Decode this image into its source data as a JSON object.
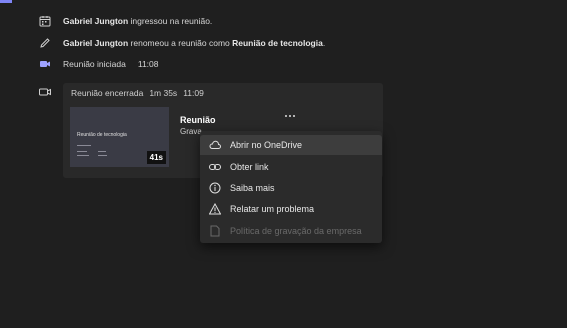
{
  "events": {
    "joined": {
      "name": "Gabriel Jungton",
      "text": " ingressou na reunião."
    },
    "renamed": {
      "name": "Gabriel Jungton",
      "text": " renomeou a reunião como ",
      "new_name": "Reunião de tecnologia",
      "end": "."
    },
    "started": {
      "label": "Reunião iniciada",
      "time": "11:08"
    }
  },
  "card": {
    "header_label": "Reunião encerrada",
    "header_duration": "1m 35s",
    "header_time": "11:09",
    "thumb_title": "Reunião de tecnologia",
    "duration_badge": "41s",
    "title": "Reunião",
    "subtitle": "Grava"
  },
  "menu": {
    "items": [
      {
        "label": "Abrir no OneDrive",
        "icon": "cloud-icon"
      },
      {
        "label": "Obter link",
        "icon": "link-icon"
      },
      {
        "label": "Saiba mais",
        "icon": "info-icon"
      },
      {
        "label": "Relatar um problema",
        "icon": "warning-icon"
      },
      {
        "label": "Política de gravação da empresa",
        "icon": "document-icon"
      }
    ]
  },
  "colors": {
    "background": "#1f1f1f",
    "card": "#292929",
    "menu": "#2b2b2b",
    "accent": "#7f85f5"
  }
}
